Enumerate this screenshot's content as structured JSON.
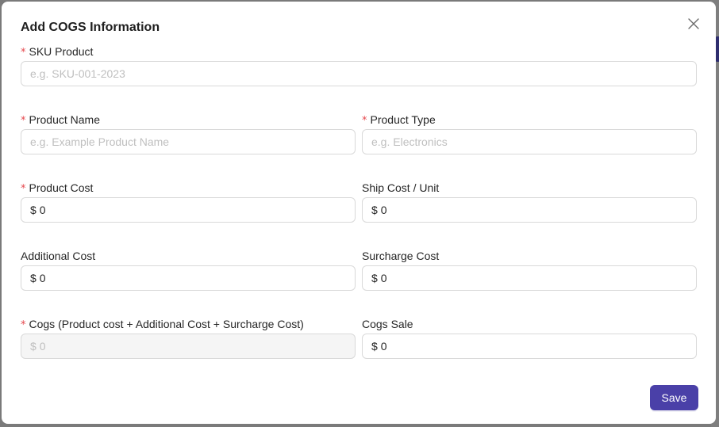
{
  "modal": {
    "title": "Add COGS Information",
    "close_icon": "close-icon",
    "save_label": "Save"
  },
  "fields": {
    "sku_product": {
      "label": "SKU Product",
      "required": true,
      "placeholder": "e.g. SKU-001-2023",
      "value": ""
    },
    "product_name": {
      "label": "Product Name",
      "required": true,
      "placeholder": "e.g. Example Product Name",
      "value": ""
    },
    "product_type": {
      "label": "Product Type",
      "required": true,
      "placeholder": "e.g. Electronics",
      "value": ""
    },
    "product_cost": {
      "label": "Product Cost",
      "required": true,
      "prefix": "$",
      "value": "0"
    },
    "ship_cost_unit": {
      "label": "Ship Cost / Unit",
      "required": false,
      "prefix": "$",
      "value": "0"
    },
    "additional_cost": {
      "label": "Additional Cost",
      "required": false,
      "prefix": "$",
      "value": "0"
    },
    "surcharge_cost": {
      "label": "Surcharge Cost",
      "required": false,
      "prefix": "$",
      "value": "0"
    },
    "cogs": {
      "label": "Cogs (Product cost + Additional Cost + Surcharge Cost)",
      "required": true,
      "prefix": "$",
      "value": "0",
      "disabled": true
    },
    "cogs_sale": {
      "label": "Cogs Sale",
      "required": false,
      "prefix": "$",
      "value": "0"
    }
  },
  "required_marker": "*",
  "colors": {
    "primary": "#4a40a8",
    "required": "#e5484d",
    "border": "#d9d9d9",
    "placeholder": "#bfbfbf"
  }
}
